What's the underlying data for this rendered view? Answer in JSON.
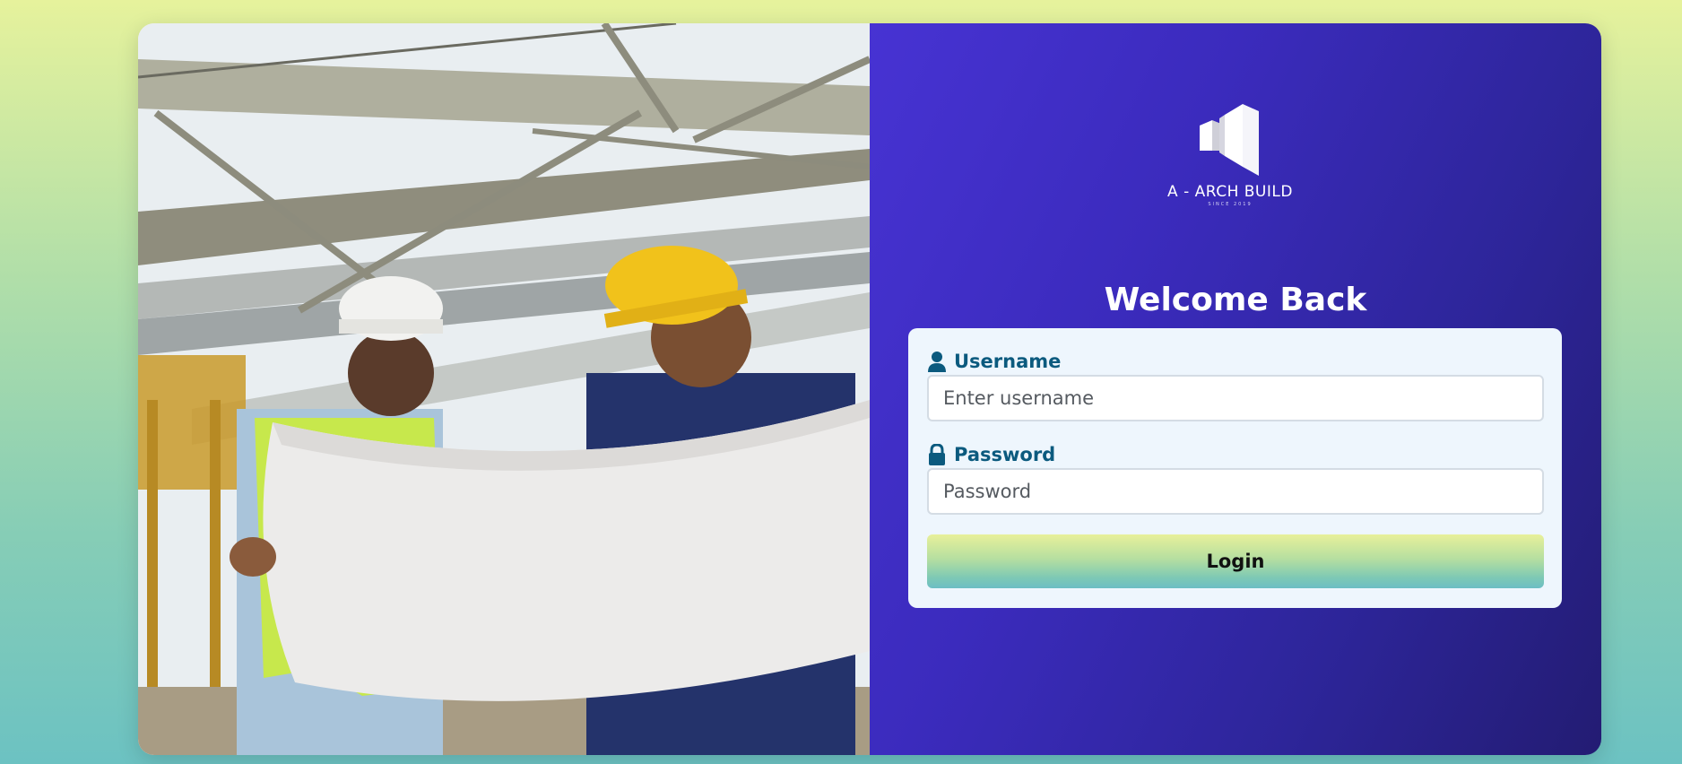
{
  "brand": {
    "logo_name": "A - ARCH BUILD",
    "logo_since": "SINCE 2019"
  },
  "login": {
    "heading": "Welcome Back",
    "username_label": "Username",
    "username_placeholder": "Enter username",
    "password_label": "Password",
    "password_placeholder": "Password",
    "submit_label": "Login"
  },
  "colors": {
    "panel": "#3b2bbd",
    "label": "#0b5a7e",
    "form_bg": "#eef6fd"
  },
  "icons": {
    "username": "user-icon",
    "password": "lock-icon"
  }
}
